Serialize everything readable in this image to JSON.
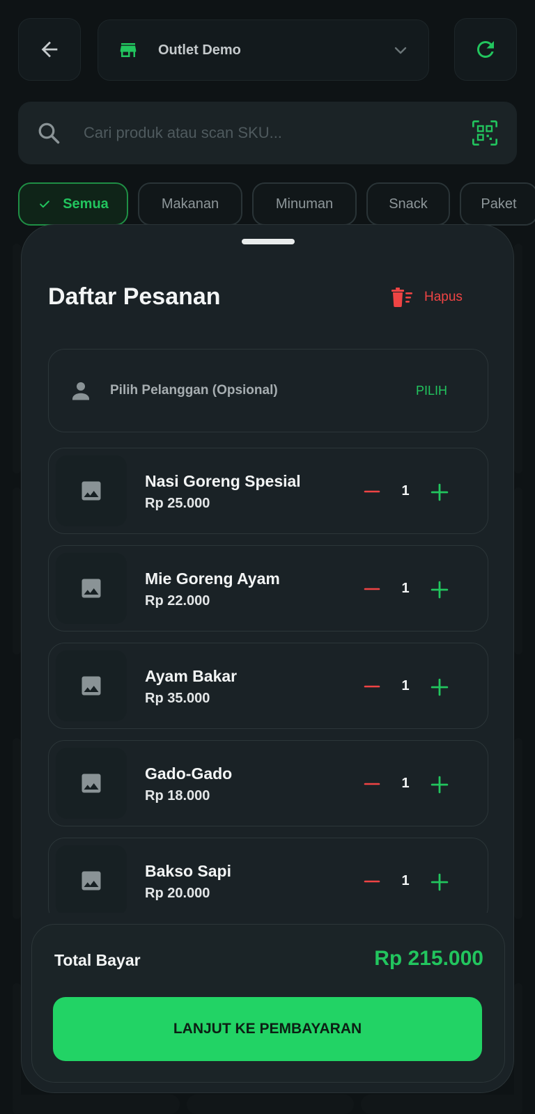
{
  "header": {
    "outlet_name": "Outlet Demo"
  },
  "search": {
    "placeholder": "Cari produk atau scan SKU..."
  },
  "categories": [
    {
      "label": "Semua",
      "active": true
    },
    {
      "label": "Makanan",
      "active": false
    },
    {
      "label": "Minuman",
      "active": false
    },
    {
      "label": "Snack",
      "active": false
    },
    {
      "label": "Paket",
      "active": false
    }
  ],
  "cart": {
    "title": "Daftar Pesanan",
    "clear_label": "Hapus",
    "customer_label": "Pilih Pelanggan (Opsional)",
    "customer_action": "PILIH",
    "items": [
      {
        "name": "Nasi Goreng Spesial",
        "price": "Rp 25.000",
        "qty": "1"
      },
      {
        "name": "Mie Goreng Ayam",
        "price": "Rp 22.000",
        "qty": "1"
      },
      {
        "name": "Ayam Bakar",
        "price": "Rp 35.000",
        "qty": "1"
      },
      {
        "name": "Gado-Gado",
        "price": "Rp 18.000",
        "qty": "1"
      },
      {
        "name": "Bakso Sapi",
        "price": "Rp 20.000",
        "qty": "1"
      }
    ],
    "total_label": "Total Bayar",
    "total_value": "Rp 215.000",
    "pay_button": "LANJUT KE PEMBAYARAN"
  },
  "colors": {
    "accent": "#22c55e",
    "danger": "#ef4444",
    "background": "#0e1315",
    "sheet": "#1a2226"
  },
  "icons": [
    "back-arrow-icon",
    "store-icon",
    "chevron-down-icon",
    "refresh-icon",
    "search-icon",
    "qr-scan-icon",
    "check-icon",
    "trash-icon",
    "person-icon",
    "image-placeholder-icon",
    "minus-icon",
    "plus-icon"
  ]
}
